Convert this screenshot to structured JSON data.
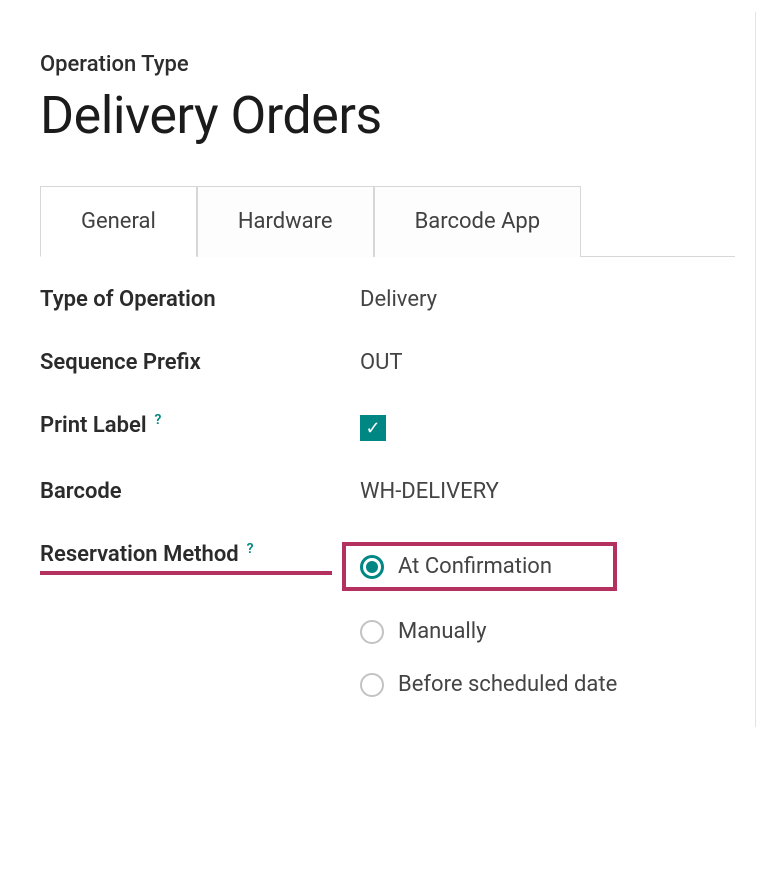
{
  "header": {
    "breadcrumb": "Operation Type",
    "title": "Delivery Orders"
  },
  "tabs": [
    {
      "label": "General",
      "active": true
    },
    {
      "label": "Hardware",
      "active": false
    },
    {
      "label": "Barcode App",
      "active": false
    }
  ],
  "fields": {
    "type_of_operation": {
      "label": "Type of Operation",
      "value": "Delivery"
    },
    "sequence_prefix": {
      "label": "Sequence Prefix",
      "value": "OUT"
    },
    "print_label": {
      "label": "Print Label",
      "checked": true,
      "help": "?"
    },
    "barcode": {
      "label": "Barcode",
      "value": "WH-DELIVERY"
    },
    "reservation_method": {
      "label": "Reservation Method",
      "help": "?",
      "options": [
        {
          "label": "At Confirmation",
          "selected": true
        },
        {
          "label": "Manually",
          "selected": false
        },
        {
          "label": "Before scheduled date",
          "selected": false
        }
      ]
    }
  }
}
